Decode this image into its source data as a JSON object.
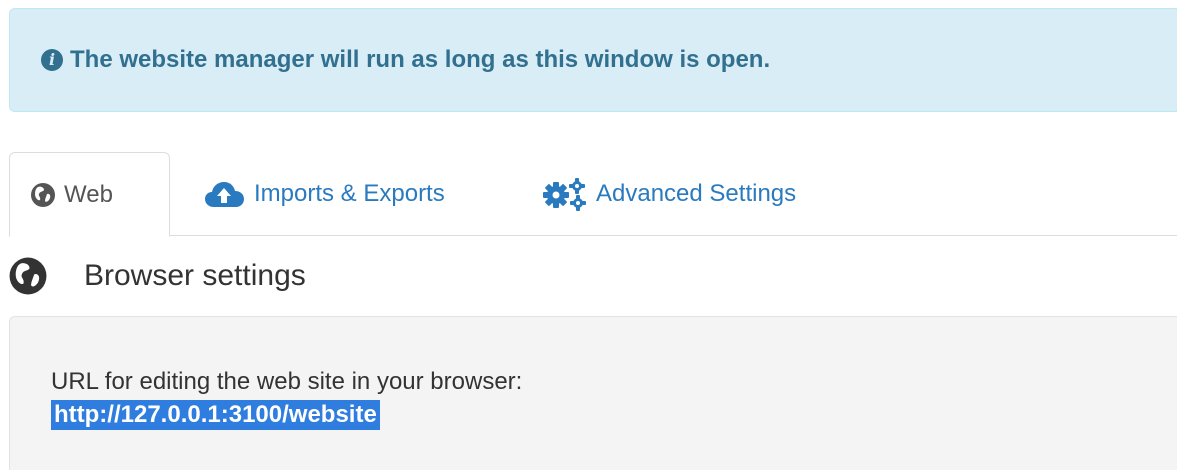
{
  "alert": {
    "icon": "info-circle-icon",
    "icon_glyph": "i",
    "message": "The website manager will run as long as this window is open."
  },
  "tabs": [
    {
      "label": "Web",
      "icon": "globe-icon",
      "active": true
    },
    {
      "label": "Imports & Exports",
      "icon": "cloud-upload-icon",
      "active": false
    },
    {
      "label": "Advanced Settings",
      "icon": "cogs-icon",
      "active": false
    }
  ],
  "section": {
    "title": "Browser settings",
    "icon": "globe-icon"
  },
  "browser_settings": {
    "label": "URL for editing the web site in your browser:",
    "url": "http://127.0.0.1:3100/website"
  },
  "colors": {
    "alert_bg": "#d9edf7",
    "alert_text": "#31708f",
    "link": "#2a7abf",
    "selection": "#2f7dde"
  }
}
